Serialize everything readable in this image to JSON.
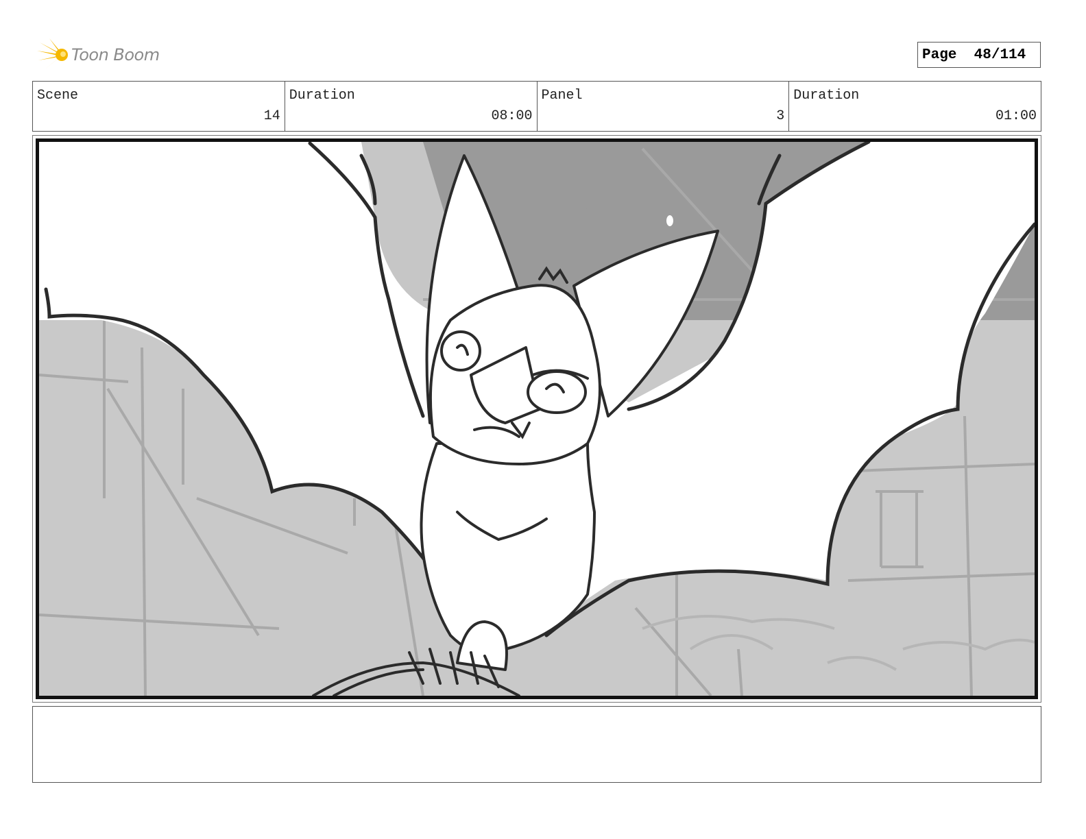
{
  "brand": {
    "name": "Toon Boom",
    "accent": "#f5b800"
  },
  "page": {
    "label": "Page",
    "number": "48/114"
  },
  "header": {
    "scene_label": "Scene",
    "scene_value": "14",
    "scene_duration_label": "Duration",
    "scene_duration_value": "08:00",
    "panel_label": "Panel",
    "panel_value": "3",
    "panel_duration_label": "Duration",
    "panel_duration_value": "01:00"
  },
  "panel_image": {
    "icon": "bat-sketch-drawing"
  },
  "notes": {
    "text": ""
  }
}
